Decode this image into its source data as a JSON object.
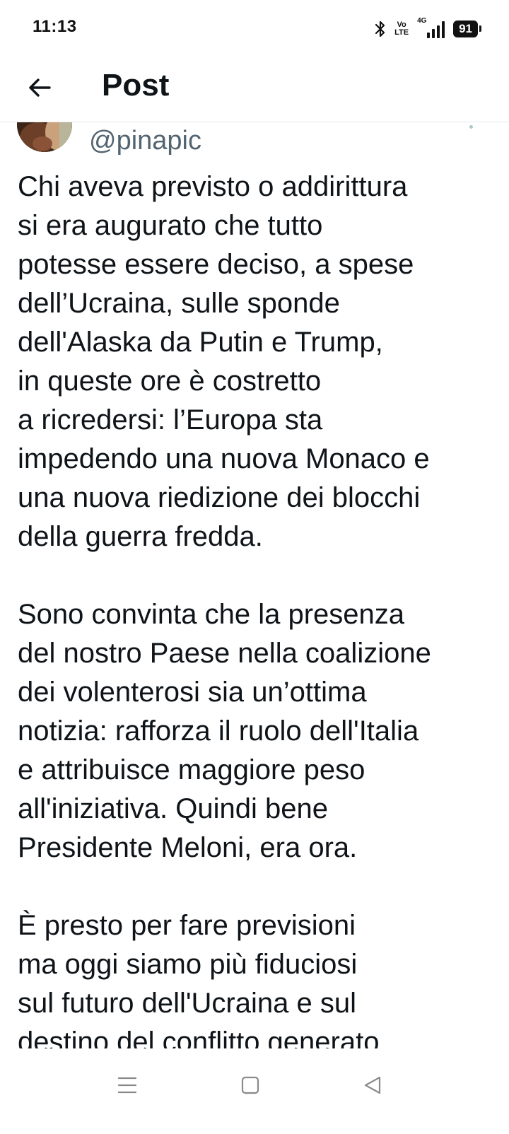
{
  "status_bar": {
    "time": "11:13",
    "volte_top": "Vo",
    "volte_bottom": "LTE",
    "network": "4G",
    "battery": "91",
    "icons": [
      "bluetooth-icon",
      "volte-icon",
      "signal-icon",
      "battery-icon"
    ]
  },
  "header": {
    "title": "Post",
    "back_icon": "arrow-left-icon"
  },
  "post": {
    "handle": "@pinapic",
    "text": "Chi aveva previsto o addirittura\nsi era augurato che tutto\npotesse essere deciso, a spese\ndell’Ucraina, sulle sponde\ndell'Alaska da Putin e Trump,\nin queste ore è costretto\na ricredersi: l’Europa sta\nimpedendo una nuova Monaco e\nuna nuova riedizione dei blocchi\ndella guerra fredda.\n\nSono convinta che la presenza\ndel nostro Paese nella coalizione\ndei volenterosi sia un’ottima\nnotizia: rafforza il ruolo dell'Italia\ne attribuisce maggiore peso\nall'iniziativa. Quindi bene\nPresidente Meloni, era ora.\n\nÈ presto per fare previsioni\nma oggi siamo più fiduciosi\nsul futuro dell'Ucraina e sul\ndestino del conflitto generato"
  },
  "nav_bar": {
    "icons": [
      "menu-icon",
      "home-square-icon",
      "back-triangle-icon"
    ]
  }
}
